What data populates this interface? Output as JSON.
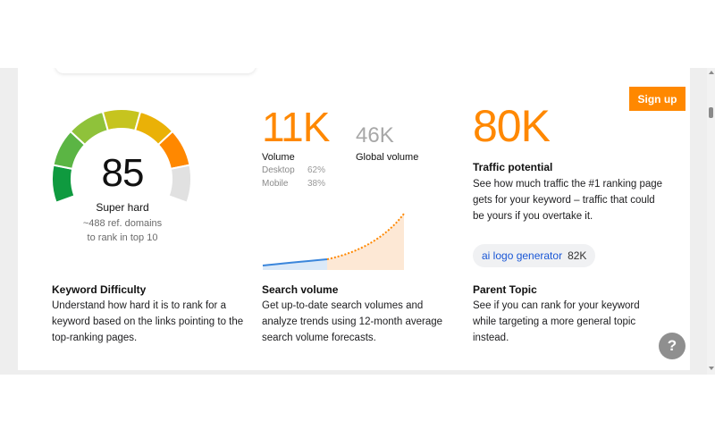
{
  "header": {
    "signup_label": "Sign up"
  },
  "keyword_difficulty": {
    "score": "85",
    "level": "Super hard",
    "note_line1": "~488 ref. domains",
    "note_line2": "to rank in top 10",
    "title": "Keyword Difficulty",
    "description": "Understand how hard it is to rank for a keyword based on the links pointing to the top-ranking pages.",
    "gauge_colors": [
      "#0f9a3f",
      "#5bb544",
      "#8fc23a",
      "#c6c41f",
      "#eab107",
      "#ff8800",
      "#e1e1e1"
    ]
  },
  "search_volume": {
    "value": "11K",
    "label": "Volume",
    "breakdown": [
      {
        "device": "Desktop",
        "share": "62%"
      },
      {
        "device": "Mobile",
        "share": "38%"
      }
    ],
    "global_value": "46K",
    "global_label": "Global volume",
    "title": "Search volume",
    "description": "Get up-to-date search volumes and analyze trends using 12-month average search volume forecasts.",
    "colors": {
      "history": "#3b86db",
      "forecast": "#ff8800"
    }
  },
  "traffic_potential": {
    "value": "80K",
    "title": "Traffic potential",
    "description": "See how much traffic the #1 ranking page gets for your keyword – traffic that could be yours if you overtake it."
  },
  "parent_topic": {
    "keyword": "ai logo generator",
    "volume": "82K",
    "title": "Parent Topic",
    "description": "See if you can rank for your keyword while targeting a more general topic instead."
  },
  "help": {
    "label": "?"
  },
  "icons": [
    "help-icon"
  ]
}
